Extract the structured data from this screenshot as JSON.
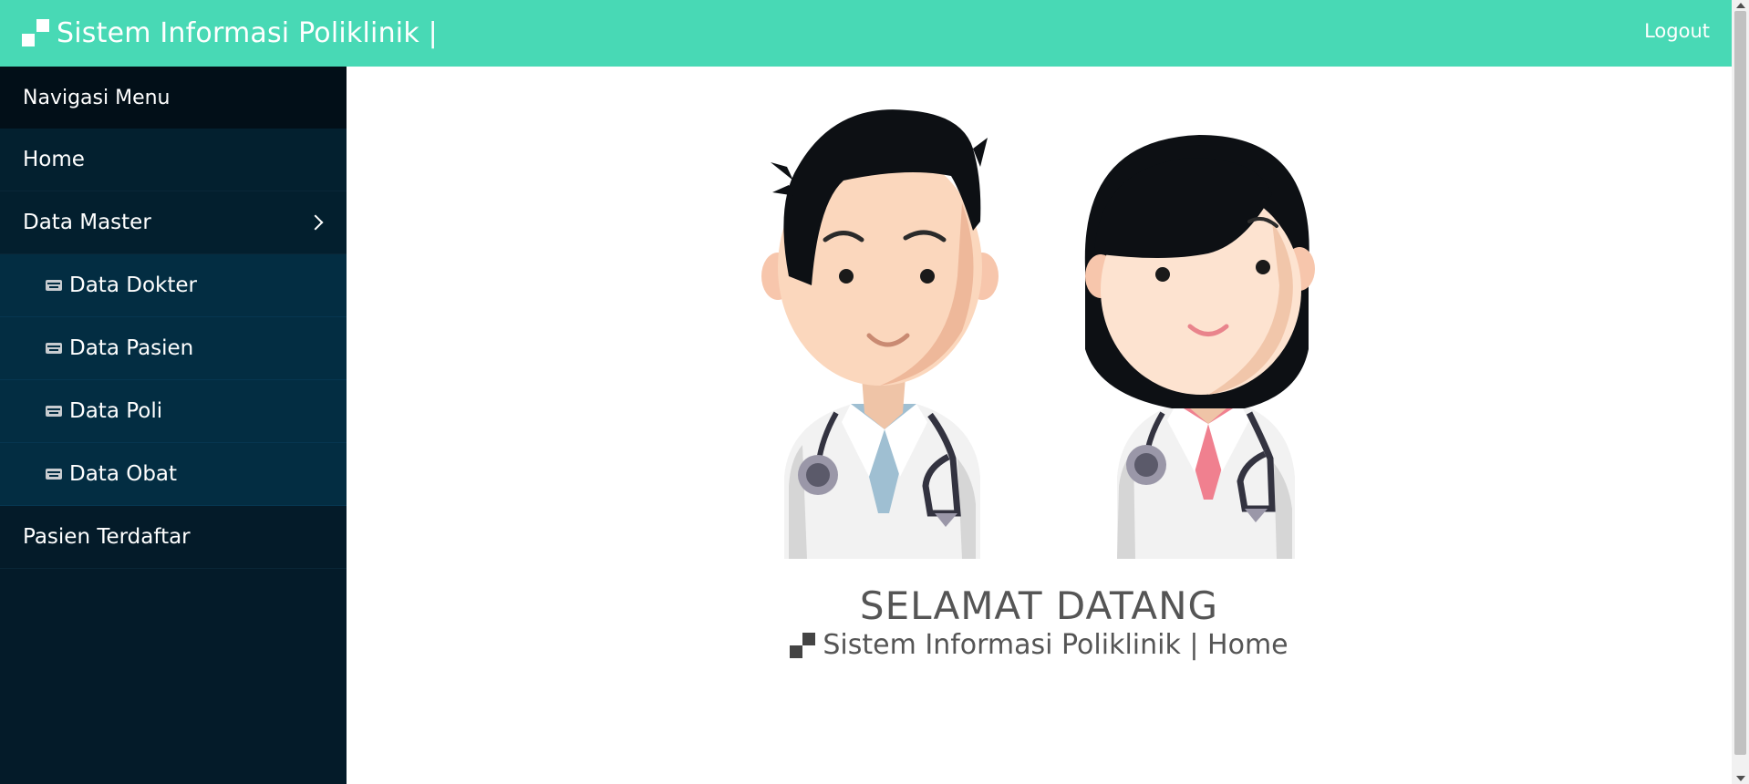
{
  "header": {
    "title": "Sistem Informasi Poliklinik  |",
    "logout_label": "Logout",
    "bg_color": "#48d9b5"
  },
  "sidebar": {
    "header": "Navigasi Menu",
    "items": [
      {
        "label": "Home"
      },
      {
        "label": "Data Master",
        "icon": "chevron-right-icon"
      },
      {
        "label": "Data Dokter",
        "icon": "card-icon"
      },
      {
        "label": "Data Pasien",
        "icon": "card-icon"
      },
      {
        "label": "Data Poli",
        "icon": "card-icon"
      },
      {
        "label": "Data Obat",
        "icon": "card-icon"
      },
      {
        "label": "Pasien Terdaftar"
      }
    ]
  },
  "main": {
    "welcome": "SELAMAT DATANG",
    "subtitle": "Sistem Informasi Poliklinik  |  Home",
    "illustration": "doctors-illustration"
  }
}
